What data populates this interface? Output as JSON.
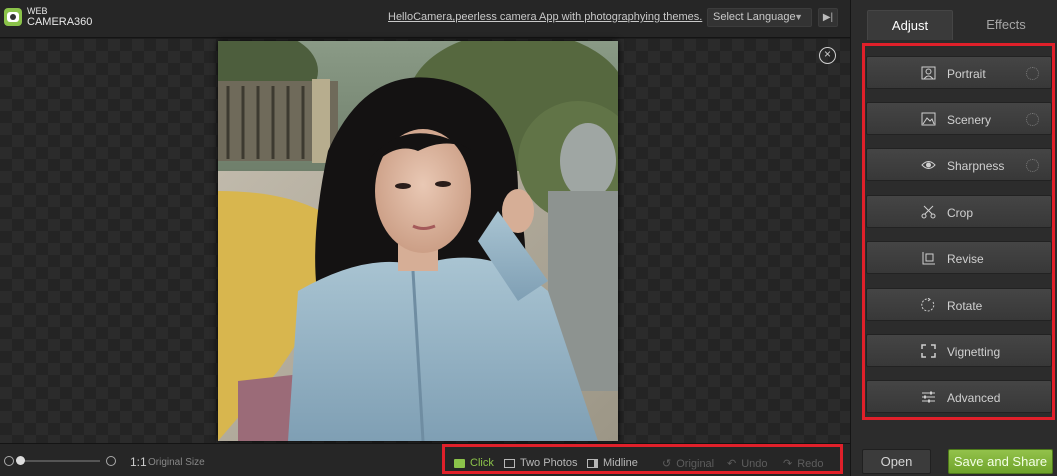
{
  "app": {
    "logo_line1": "WEB",
    "logo_line2": "CAMERA360",
    "tagline": "HelloCamera,peerless camera App with photographying themes."
  },
  "topbar": {
    "language_select": "Select Language"
  },
  "photo": {
    "description_icon": "photo-portrait"
  },
  "bottombar": {
    "ratio": "1:1",
    "ratio_label": "Original Size",
    "tools": [
      {
        "label": "Click",
        "state": "active",
        "icon": "click-icon"
      },
      {
        "label": "Two Photos",
        "state": "normal",
        "icon": "two-photos-icon"
      },
      {
        "label": "Midline",
        "state": "normal",
        "icon": "midline-icon"
      },
      {
        "label": "Original",
        "state": "disabled",
        "icon": "original-icon"
      },
      {
        "label": "Undo",
        "state": "disabled",
        "icon": "undo-icon"
      },
      {
        "label": "Redo",
        "state": "disabled",
        "icon": "redo-icon"
      }
    ]
  },
  "panel": {
    "tabs": [
      {
        "label": "Adjust",
        "selected": true
      },
      {
        "label": "Effects",
        "selected": false
      }
    ],
    "adjust_items": [
      {
        "label": "Portrait",
        "icon": "portrait-icon",
        "spinner": true
      },
      {
        "label": "Scenery",
        "icon": "scenery-icon",
        "spinner": true
      },
      {
        "label": "Sharpness",
        "icon": "eye-icon",
        "spinner": true
      },
      {
        "label": "Crop",
        "icon": "scissors-icon",
        "spinner": false
      },
      {
        "label": "Revise",
        "icon": "revise-icon",
        "spinner": false
      },
      {
        "label": "Rotate",
        "icon": "rotate-icon",
        "spinner": false
      },
      {
        "label": "Vignetting",
        "icon": "vignetting-icon",
        "spinner": false
      },
      {
        "label": "Advanced",
        "icon": "sliders-icon",
        "spinner": false
      }
    ],
    "open_label": "Open",
    "save_label": "Save and Share"
  },
  "colors": {
    "accent": "#8bc34a",
    "highlight_box": "#e0202a"
  }
}
